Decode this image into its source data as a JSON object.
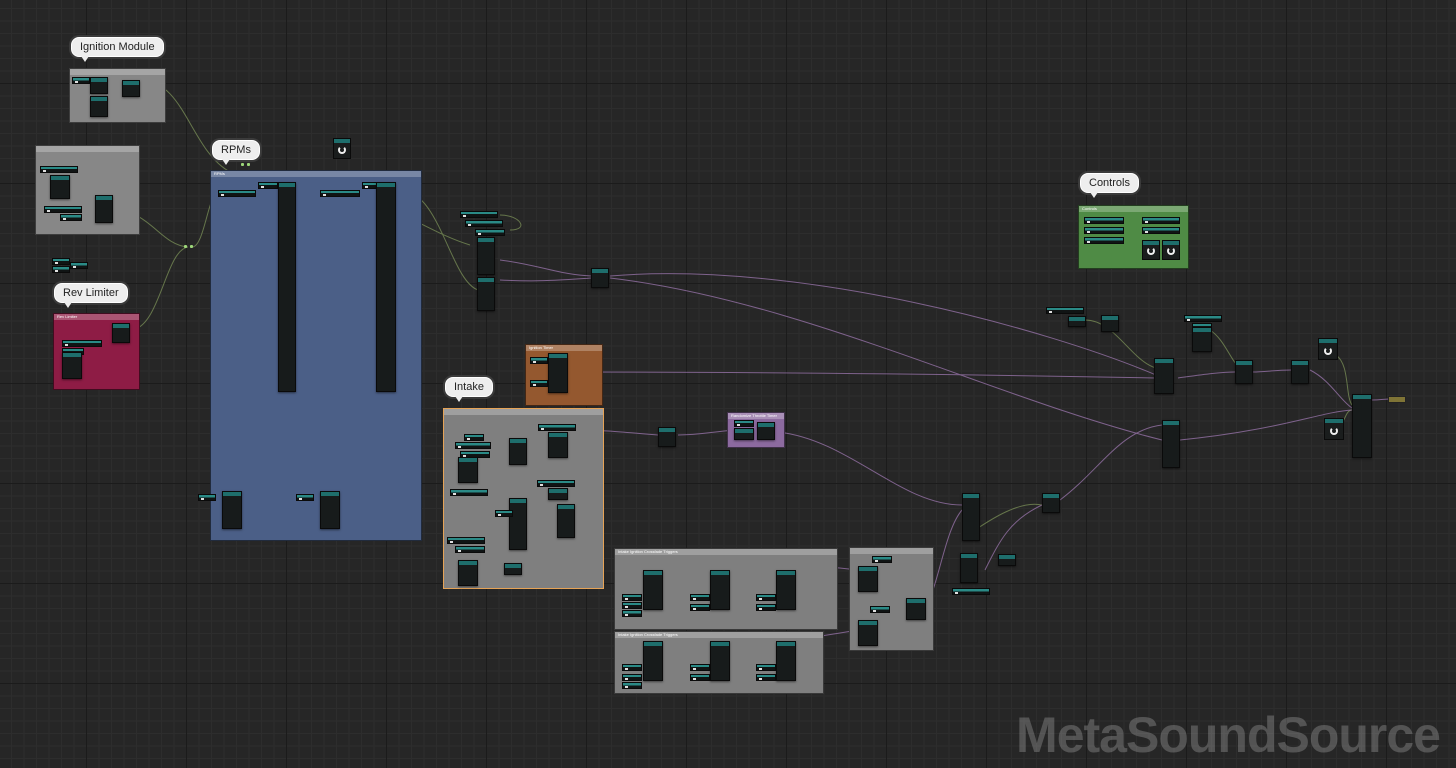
{
  "graph": {
    "asset_type": "MetaSoundSource",
    "colors": {
      "canvas": "#262626",
      "wire_audio": "#b98ad0",
      "wire_float": "#9ab86a",
      "node_header": "#1e6e6c"
    }
  },
  "bubbles": {
    "ignition": "Ignition Module",
    "rpms": "RPMs",
    "rev_limiter": "Rev Limiter",
    "intake": "Intake",
    "controls": "Controls"
  },
  "comments": {
    "ignition_box": "",
    "left_box": "",
    "rev_limiter_box": "Rev Limiter",
    "rpms_box": "RPMs",
    "intake_box": "",
    "ignition_timer_box": "Ignition Timer",
    "purple_box": "Randomize Throttle Timer",
    "gray_upper_box": "Intake Ignition Crossfade Triggers",
    "gray_lower_box": "Intake Ignition Crossfade Triggers",
    "gray_right_box": "",
    "controls_box": "Controls"
  }
}
